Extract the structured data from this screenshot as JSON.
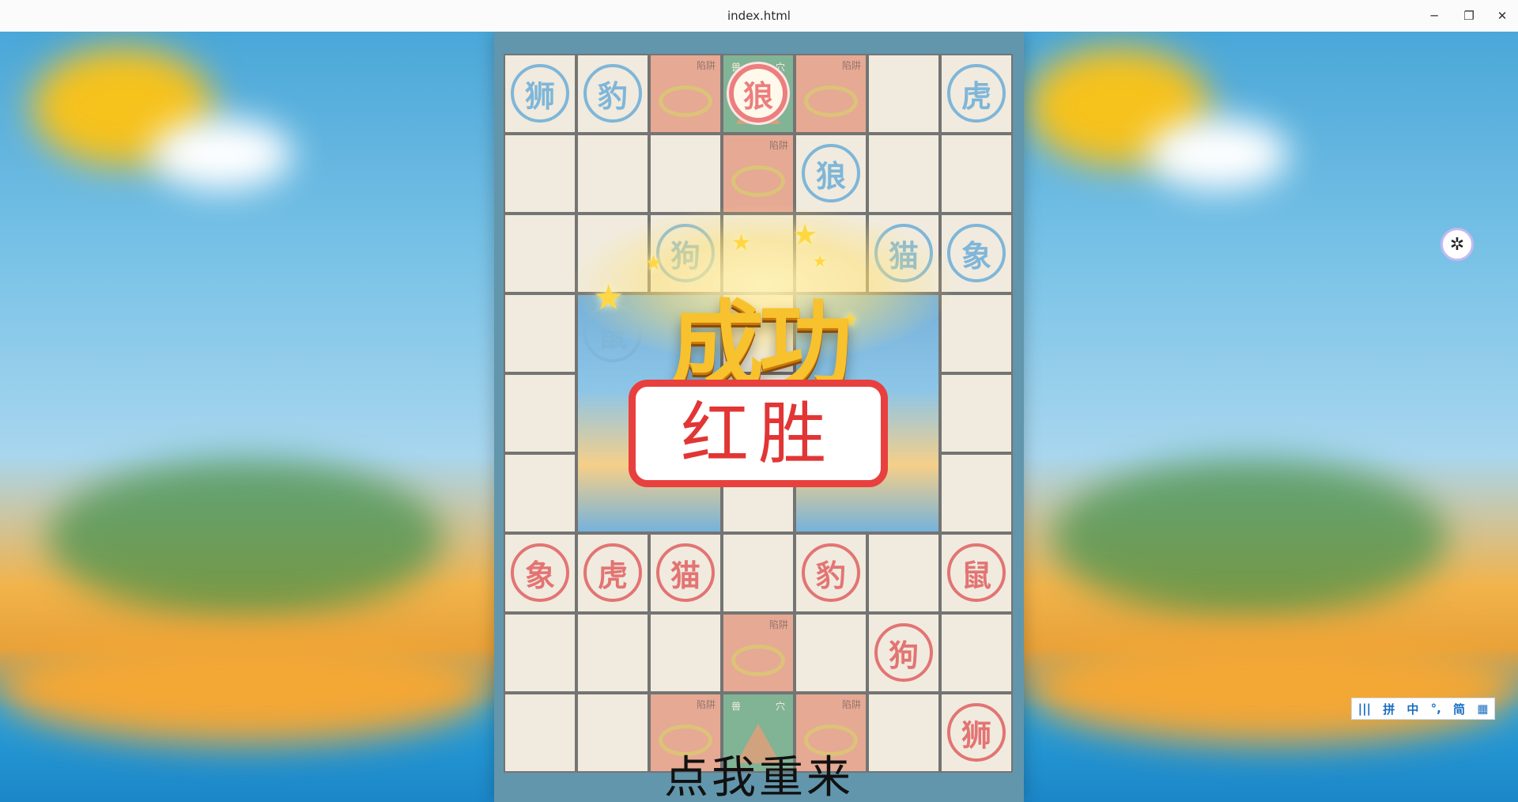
{
  "window": {
    "title": "index.html",
    "minimize": "─",
    "maximize": "❐",
    "close": "✕"
  },
  "board": {
    "pieces": [
      {
        "label": "狮",
        "side": "blue",
        "col": 0,
        "row": 0
      },
      {
        "label": "豹",
        "side": "blue",
        "col": 1,
        "row": 0
      },
      {
        "label": "狼",
        "side": "red",
        "col": 3,
        "row": 0,
        "selected": true
      },
      {
        "label": "虎",
        "side": "blue",
        "col": 6,
        "row": 0
      },
      {
        "label": "狼",
        "side": "blue",
        "col": 4,
        "row": 1
      },
      {
        "label": "狗",
        "side": "blue",
        "col": 2,
        "row": 2
      },
      {
        "label": "猫",
        "side": "blue",
        "col": 5,
        "row": 2
      },
      {
        "label": "象",
        "side": "blue",
        "col": 6,
        "row": 2
      },
      {
        "label": "鼠",
        "side": "blue",
        "col": 1,
        "row": 3
      },
      {
        "label": "象",
        "side": "red",
        "col": 0,
        "row": 6
      },
      {
        "label": "虎",
        "side": "red",
        "col": 1,
        "row": 6
      },
      {
        "label": "猫",
        "side": "red",
        "col": 2,
        "row": 6
      },
      {
        "label": "豹",
        "side": "red",
        "col": 4,
        "row": 6
      },
      {
        "label": "鼠",
        "side": "red",
        "col": 6,
        "row": 6
      },
      {
        "label": "狗",
        "side": "red",
        "col": 5,
        "row": 7
      },
      {
        "label": "狮",
        "side": "red",
        "col": 6,
        "row": 8
      }
    ],
    "trap_label": "陷阱",
    "den_label_left": "兽",
    "den_label_right": "穴"
  },
  "result": {
    "banner": "成功",
    "winner": "红胜",
    "restart": "点我重来"
  },
  "assistant": {
    "icon": "assistant-icon",
    "glyph": "✲"
  },
  "ime": {
    "voice": "|||",
    "pinyin": "拼",
    "lang": "中",
    "punct": "°,",
    "script": "简",
    "menu": "▦"
  },
  "colors": {
    "blue_side": "#3b8fc4",
    "red_side": "#d42a2a",
    "banner": "#f7c22e"
  }
}
